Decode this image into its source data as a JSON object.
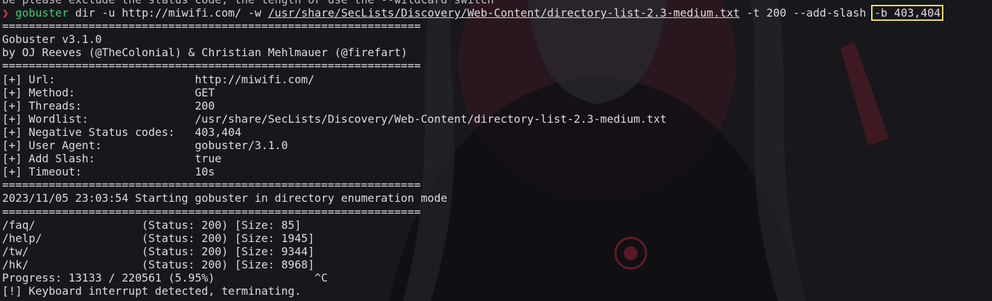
{
  "terminal": {
    "cut_line": "be please exclude the status code, the length or use the --wildcard switch",
    "prompt": {
      "arrow": "❯",
      "command": "gobuster",
      "args_before_path": " dir -u http://miwifi.com/ -w ",
      "wordlist_path": "/usr/share/SecLists/Discovery/Web-Content/directory-list-2.3-medium.txt",
      "args_after_path": " -t 200 --add-slash ",
      "highlighted_arg": "-b 403,404"
    },
    "separator": "===============================================================",
    "banner_version": "Gobuster v3.1.0",
    "banner_authors": "by OJ Reeves (@TheColonial) & Christian Mehlmauer (@firefart)",
    "config": [
      {
        "key": "[+] Url:                     ",
        "value": "http://miwifi.com/"
      },
      {
        "key": "[+] Method:                  ",
        "value": "GET"
      },
      {
        "key": "[+] Threads:                 ",
        "value": "200"
      },
      {
        "key": "[+] Wordlist:                ",
        "value": "/usr/share/SecLists/Discovery/Web-Content/directory-list-2.3-medium.txt"
      },
      {
        "key": "[+] Negative Status codes:   ",
        "value": "403,404"
      },
      {
        "key": "[+] User Agent:              ",
        "value": "gobuster/3.1.0"
      },
      {
        "key": "[+] Add Slash:               ",
        "value": "true"
      },
      {
        "key": "[+] Timeout:                 ",
        "value": "10s"
      }
    ],
    "start_message": "2023/11/05 23:03:54 Starting gobuster in directory enumeration mode",
    "results": [
      {
        "path": "/faq/                ",
        "status": "(Status: 200)",
        "size": "[Size: 85]"
      },
      {
        "path": "/help/               ",
        "status": "(Status: 200)",
        "size": "[Size: 1945]"
      },
      {
        "path": "/tw/                 ",
        "status": "(Status: 200)",
        "size": "[Size: 9344]"
      },
      {
        "path": "/hk/                 ",
        "status": "(Status: 200)",
        "size": "[Size: 8968]"
      }
    ],
    "progress": "Progress: 13133 / 220561 (5.95%)               ^C",
    "interrupt": "[!] Keyboard interrupt detected, terminating."
  },
  "colors": {
    "background": "#17171c",
    "text": "#dcdce0",
    "prompt_arrow": "#e8394f",
    "command": "#3bd16f",
    "highlight_box": "#f5e44a"
  }
}
